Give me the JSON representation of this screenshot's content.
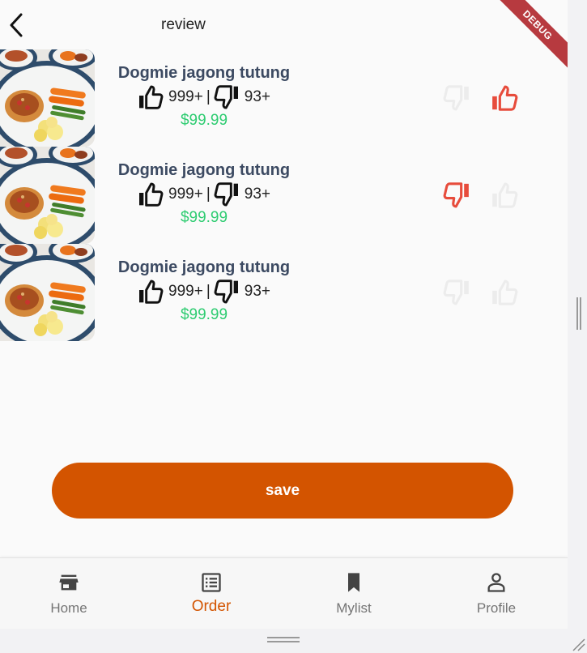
{
  "header": {
    "title": "review",
    "debug_label": "DEBUG"
  },
  "items": [
    {
      "name": "Dogmie jagong tutung",
      "likes": "999+",
      "separator": "|",
      "dislikes": "93+",
      "price": "$99.99",
      "vote": "up"
    },
    {
      "name": "Dogmie jagong tutung",
      "likes": "999+",
      "separator": "|",
      "dislikes": "93+",
      "price": "$99.99",
      "vote": "down"
    },
    {
      "name": "Dogmie jagong tutung",
      "likes": "999+",
      "separator": "|",
      "dislikes": "93+",
      "price": "$99.99",
      "vote": "none"
    }
  ],
  "save_label": "save",
  "nav": {
    "items": [
      {
        "label": "Home",
        "icon": "store-icon",
        "active": false
      },
      {
        "label": "Order",
        "icon": "list-icon",
        "active": true
      },
      {
        "label": "Mylist",
        "icon": "bookmark-icon",
        "active": false
      },
      {
        "label": "Profile",
        "icon": "person-icon",
        "active": false
      }
    ]
  },
  "colors": {
    "accent": "#d35400",
    "vote_active": "#e74c3c",
    "vote_inactive": "#ececec",
    "price": "#2ecc71",
    "item_name": "#3c4a62",
    "debug_banner": "#b73a3f"
  }
}
